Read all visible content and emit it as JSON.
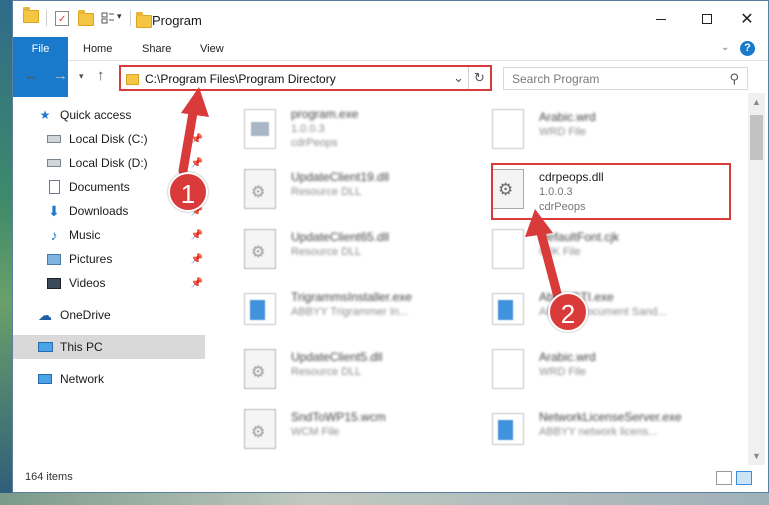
{
  "window": {
    "title": "Program",
    "quick_access_dropdown": "▾"
  },
  "ribbon": {
    "tabs": [
      "File",
      "Home",
      "Share",
      "View"
    ],
    "help": "?"
  },
  "address": {
    "path": "C:\\Program Files\\Program Directory",
    "search_placeholder": "Search Program"
  },
  "sidebar": {
    "items": [
      {
        "label": "Quick access",
        "icon": "star-icon",
        "pinned": false
      },
      {
        "label": "Local Disk (C:)",
        "icon": "drive-icon",
        "pinned": true
      },
      {
        "label": "Local Disk (D:)",
        "icon": "drive-icon",
        "pinned": true
      },
      {
        "label": "Documents",
        "icon": "documents-icon",
        "pinned": true
      },
      {
        "label": "Downloads",
        "icon": "download-icon",
        "pinned": true
      },
      {
        "label": "Music",
        "icon": "music-icon",
        "pinned": true
      },
      {
        "label": "Pictures",
        "icon": "pictures-icon",
        "pinned": true
      },
      {
        "label": "Videos",
        "icon": "videos-icon",
        "pinned": true
      },
      {
        "label": "OneDrive",
        "icon": "onedrive-icon",
        "pinned": false
      },
      {
        "label": "This PC",
        "icon": "pc-icon",
        "pinned": false,
        "selected": true
      },
      {
        "label": "Network",
        "icon": "network-icon",
        "pinned": false
      }
    ]
  },
  "files": {
    "left": [
      {
        "name": "program.exe",
        "line2": "1.0.0.3",
        "line3": "cdrPeops",
        "icon": "exe"
      },
      {
        "name": "UpdateClient19.dll",
        "line2": "Resource DLL",
        "icon": "gear"
      },
      {
        "name": "UpdateClient65.dll",
        "line2": "Resource DLL",
        "icon": "gear"
      },
      {
        "name": "TrigrammsInstaller.exe",
        "line2": "ABBYY Trigrammer In...",
        "icon": "app"
      },
      {
        "name": "UpdateClient5.dll",
        "line2": "Resource DLL",
        "icon": "gear"
      },
      {
        "name": "SndToWP15.wcm",
        "line2": "WCM File",
        "icon": "gear"
      }
    ],
    "right": [
      {
        "name": "Arabic.wrd",
        "line2": "WRD File",
        "icon": "doc"
      },
      {
        "name": "cdrpeops.dll",
        "line2": "1.0.0.3",
        "line3": "cdrPeops",
        "icon": "gear",
        "highlight": true
      },
      {
        "name": "DefaultFont.cjk",
        "line2": "CJK File",
        "icon": "doc"
      },
      {
        "name": "AbbyySTI.exe",
        "line2": "ABBYY Document Sand...",
        "icon": "app"
      },
      {
        "name": "Arabic.wrd",
        "line2": "WRD File",
        "icon": "doc"
      },
      {
        "name": "NetworkLicenseServer.exe",
        "line2": "ABBYY network licens...",
        "icon": "app"
      }
    ]
  },
  "status": {
    "count": "164 items"
  },
  "callouts": [
    "1",
    "2"
  ],
  "colors": {
    "accent": "#1979ca",
    "highlight": "#d93a3a"
  }
}
